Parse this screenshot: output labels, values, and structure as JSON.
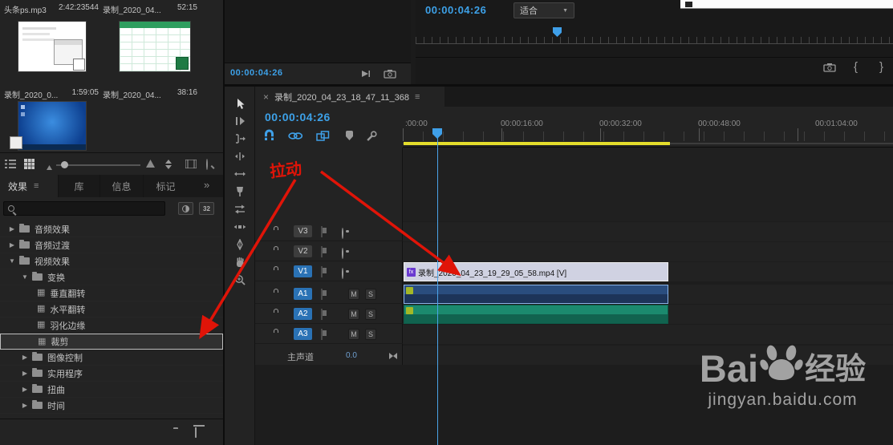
{
  "icons": {
    "twirl_open": "▼",
    "twirl_closed": "▶",
    "effect_grid": "▦",
    "panel_menu": "≡",
    "more_tabs": "»",
    "close": "×",
    "dropdown_caret": "▼"
  },
  "project_panel": {
    "items": [
      {
        "name": "头条ps.mp3",
        "meta": "2:42:23544"
      },
      {
        "name": "录制_2020_04...",
        "meta": "52:15"
      },
      {
        "name": "录制_2020_0...",
        "meta": "1:59:05"
      },
      {
        "name": "录制_2020_04...",
        "meta": "38:16"
      }
    ]
  },
  "effects_panel": {
    "tabs": [
      {
        "label": "效果"
      },
      {
        "label": "库"
      },
      {
        "label": "信息"
      },
      {
        "label": "标记"
      }
    ],
    "bit_depth_badge": "32",
    "tree": [
      {
        "label": "音频效果"
      },
      {
        "label": "音频过渡"
      },
      {
        "label": "视频效果"
      },
      {
        "label": "变换"
      },
      {
        "label": "垂直翻转"
      },
      {
        "label": "水平翻转"
      },
      {
        "label": "羽化边缘"
      },
      {
        "label": "裁剪"
      },
      {
        "label": "图像控制"
      },
      {
        "label": "实用程序"
      },
      {
        "label": "扭曲"
      },
      {
        "label": "时间"
      }
    ]
  },
  "source_monitor": {
    "timecode": "00:00:04:26"
  },
  "program_monitor": {
    "timecode": "00:00:04:26",
    "zoom_level": "适合",
    "lift_icon": "{",
    "extract_icon": "}"
  },
  "timeline": {
    "tab_title": "录制_2020_04_23_18_47_11_368",
    "timecode": "00:00:04:26",
    "ruler_labels": [
      ":00:00",
      "00:00:16:00",
      "00:00:32:00",
      "00:00:48:00",
      "00:01:04:00"
    ],
    "video_tracks": [
      {
        "label": "V3"
      },
      {
        "label": "V2"
      },
      {
        "label": "V1"
      }
    ],
    "audio_tracks": [
      {
        "label": "A1"
      },
      {
        "label": "A2"
      },
      {
        "label": "A3"
      }
    ],
    "mute_label": "M",
    "solo_label": "S",
    "master_label": "主声道",
    "master_value": "0.0",
    "video_clip_label": "录制_2020_04_23_19_29_05_58.mp4 [V]",
    "fx_badge": "fx"
  },
  "annotation": {
    "text": "拉动"
  },
  "watermark": {
    "brand_latin": "Bai",
    "brand_suffix": "经验",
    "url": "jingyan.baidu.com"
  }
}
